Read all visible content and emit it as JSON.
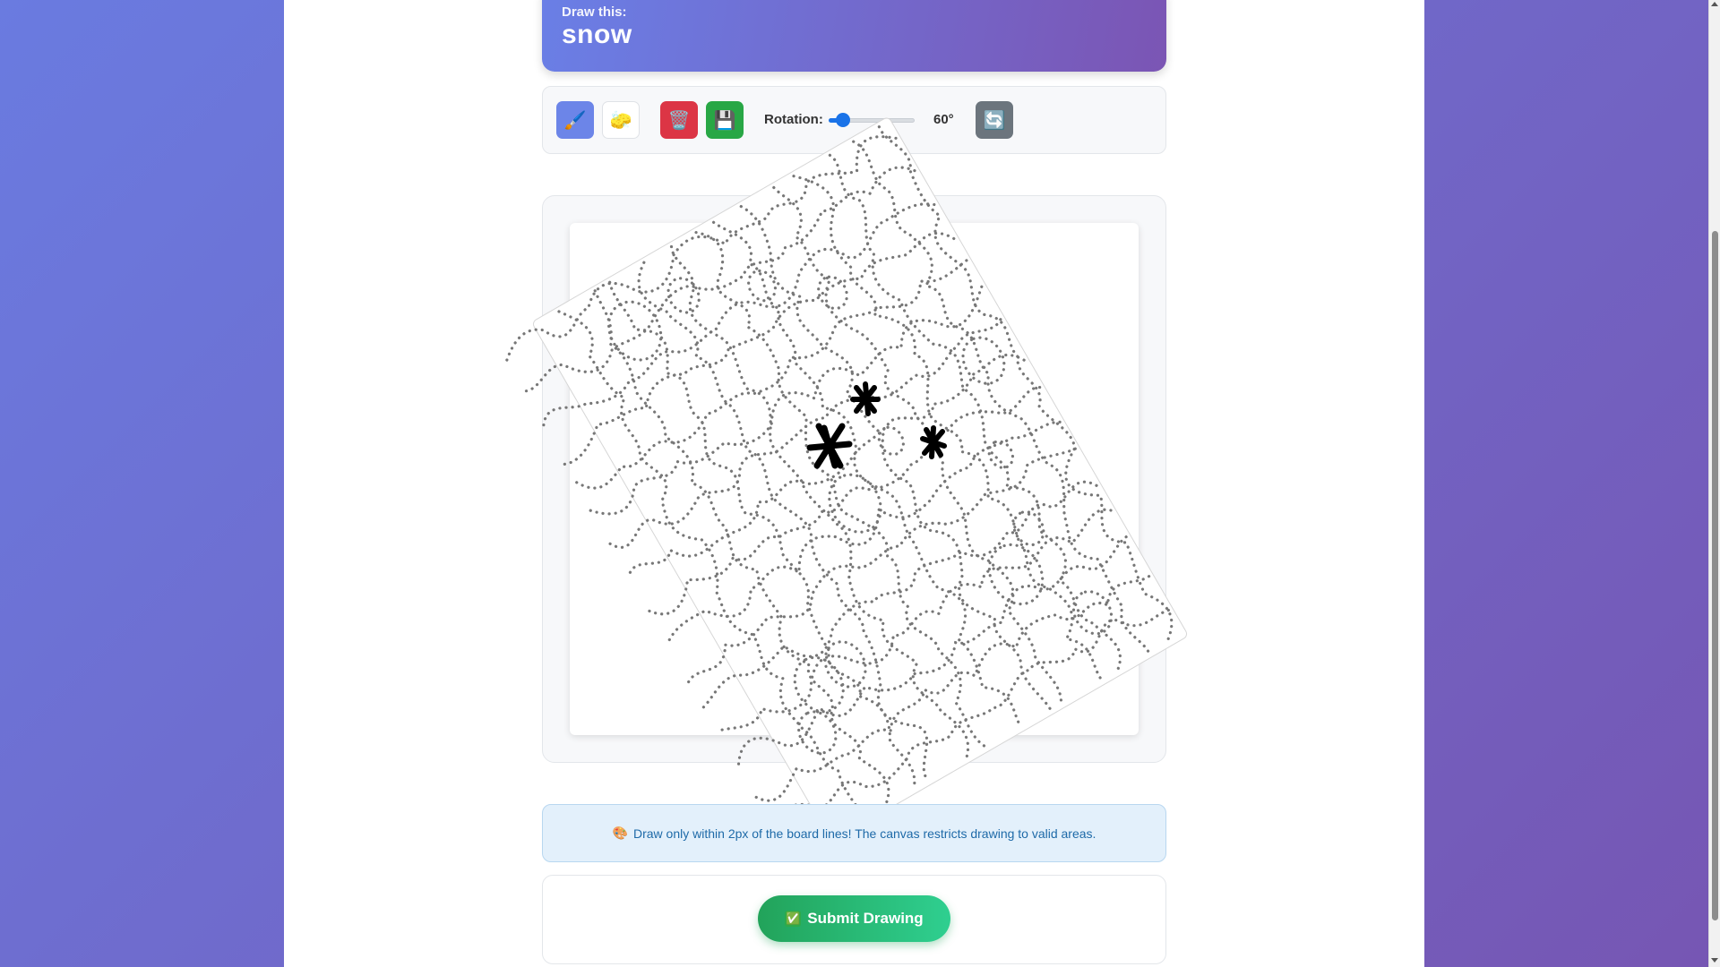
{
  "prompt": {
    "label": "Draw this:",
    "word": "snow"
  },
  "toolbar": {
    "tools": [
      {
        "name": "brush",
        "icon": "brush-icon",
        "glyph": "🖌️",
        "active": true
      },
      {
        "name": "eraser",
        "icon": "eraser-icon",
        "glyph": "🧽",
        "active": false
      },
      {
        "name": "clear",
        "icon": "trash-icon",
        "glyph": "🗑️"
      },
      {
        "name": "save",
        "icon": "save-icon",
        "glyph": "💾"
      }
    ],
    "rotation_label": "Rotation:",
    "rotation_value": "60°",
    "rotation_fraction": 0.17,
    "reset_icon": "rotate-reset-icon",
    "reset_glyph": "🔄"
  },
  "canvas": {
    "rotation_degrees": 60
  },
  "hint": {
    "icon": "🎨",
    "text": "Draw only within 2px of the board lines! The canvas restricts drawing to valid areas."
  },
  "submit": {
    "icon": "✅",
    "label": "Submit Drawing"
  },
  "colors": {
    "brand_gradient_start": "#6a7fe6",
    "brand_gradient_end": "#7b55b4",
    "clear": "#dc3545",
    "save": "#28a745",
    "submit_start": "#22a35a",
    "submit_end": "#2fcf90",
    "board_line": "#777777",
    "stroke": "#000000"
  }
}
